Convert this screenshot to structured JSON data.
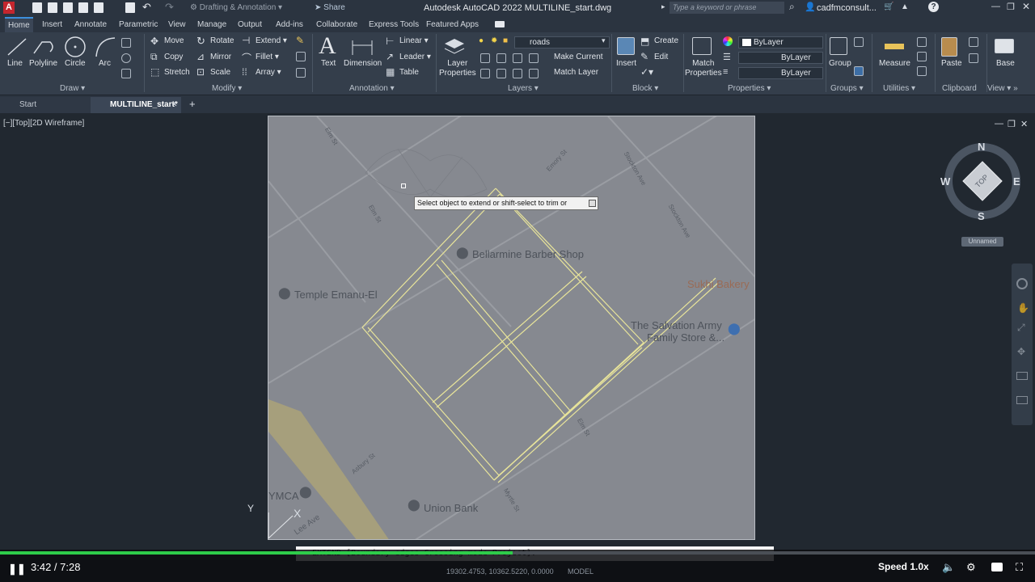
{
  "titlebar": {
    "workspace": "Drafting & Annotation",
    "share": "Share",
    "title": "Autodesk AutoCAD 2022    MULTILINE_start.dwg",
    "search_placeholder": "Type a keyword or phrase",
    "user": "cadfmconsult..."
  },
  "tabs": [
    "Home",
    "Insert",
    "Annotate",
    "Parametric",
    "View",
    "Manage",
    "Output",
    "Add-ins",
    "Collaborate",
    "Express Tools",
    "Featured Apps"
  ],
  "ribbon": {
    "draw": {
      "label": "Draw",
      "line": "Line",
      "polyline": "Polyline",
      "circle": "Circle",
      "arc": "Arc"
    },
    "modify": {
      "label": "Modify",
      "move": "Move",
      "rotate": "Rotate",
      "extend": "Extend",
      "copy": "Copy",
      "mirror": "Mirror",
      "fillet": "Fillet",
      "stretch": "Stretch",
      "scale": "Scale",
      "array": "Array"
    },
    "annotation": {
      "label": "Annotation",
      "text": "Text",
      "dimension": "Dimension",
      "linear": "Linear",
      "leader": "Leader",
      "table": "Table"
    },
    "layers": {
      "label": "Layers",
      "layer_properties_1": "Layer",
      "layer_properties_2": "Properties",
      "current_layer": "roads",
      "make_current": "Make Current",
      "match_layer": "Match Layer"
    },
    "block": {
      "label": "Block",
      "insert": "Insert",
      "create": "Create",
      "edit": "Edit"
    },
    "properties": {
      "label": "Properties",
      "match_1": "Match",
      "match_2": "Properties",
      "bylayer_color": "ByLayer",
      "bylayer_line": "ByLayer",
      "bylayer_weight": "ByLayer"
    },
    "groups": {
      "label": "Groups",
      "group": "Group"
    },
    "utilities": {
      "label": "Utilities",
      "measure": "Measure"
    },
    "clipboard": {
      "label": "Clipboard",
      "paste": "Paste"
    },
    "view": {
      "label": "View",
      "base": "Base"
    }
  },
  "doctabs": {
    "start": "Start",
    "active": "MULTILINE_start*"
  },
  "viewport": {
    "label": "[−][Top][2D Wireframe]"
  },
  "map": {
    "places": {
      "barber": "Bellarmine Barber Shop",
      "temple": "Temple Emanu-El",
      "bakery": "Sukhi Bakery",
      "salvation_1": "The Salvation Army",
      "salvation_2": "Family Store &...",
      "ymca": "YMCA",
      "bank": "Union Bank"
    },
    "streets": {
      "elm1": "Elm St",
      "elm2": "Elm St",
      "elm3": "Elm St",
      "emory": "Emory St",
      "stockton1": "Stockton Ave",
      "stockton2": "Stockton Ave",
      "asbury": "Asbury St",
      "myrtle": "Myrtle St",
      "lee": "Lee Ave"
    }
  },
  "tooltip": "Select object to extend or shift-select to trim or",
  "viewcube": {
    "n": "N",
    "s": "S",
    "e": "E",
    "w": "W",
    "top": "TOP",
    "ucs": "Unnamed"
  },
  "ucs": {
    "x": "X",
    "y": "Y"
  },
  "command": "EXTEND [Boundary edges Crossing mode Project]:",
  "status": {
    "coords": "19302.4753, 10362.5220, 0.0000",
    "model": "MODEL"
  },
  "player": {
    "time": "3:42 / 7:28",
    "speed": "Speed 1.0x",
    "progress": 0.495
  },
  "colors": {
    "accent": "#3c8fdc",
    "progress": "#2ecc4a",
    "multiline": "#e8e49a"
  }
}
